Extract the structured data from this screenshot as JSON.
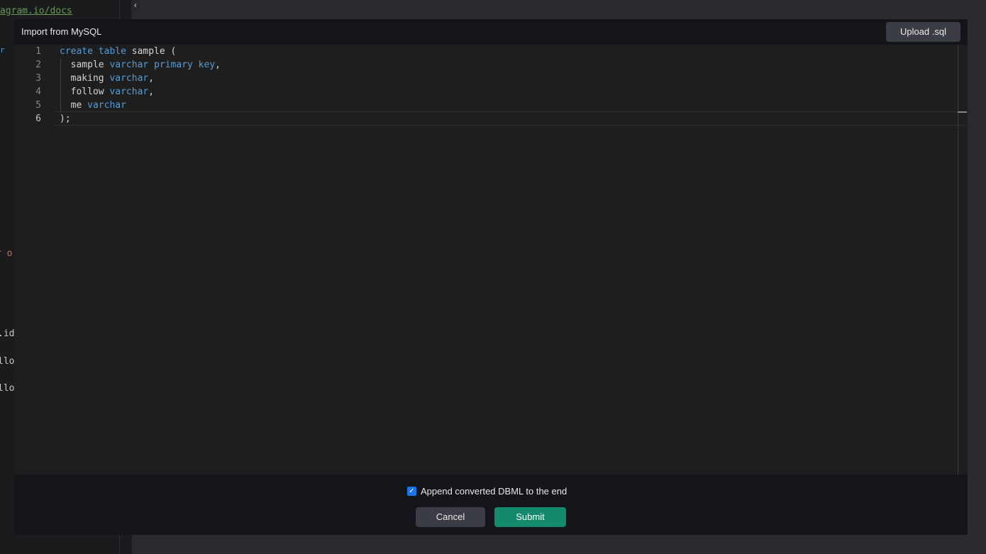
{
  "background": {
    "fragments": [
      "agram.io/docs",
      "r",
      "r o",
      ".id",
      "llo",
      "llo"
    ],
    "toggle_glyph": "‹"
  },
  "modal": {
    "title": "Import from MySQL",
    "upload_label": "Upload .sql",
    "editor": {
      "active_line": 6,
      "lines": [
        {
          "number": "1",
          "tokens": [
            {
              "t": "create table",
              "k": true
            },
            {
              "t": " sample (",
              "k": false
            }
          ]
        },
        {
          "number": "2",
          "tokens": [
            {
              "t": "  sample ",
              "k": false
            },
            {
              "t": "varchar primary key",
              "k": true
            },
            {
              "t": ",",
              "k": false
            }
          ]
        },
        {
          "number": "3",
          "tokens": [
            {
              "t": "  making ",
              "k": false
            },
            {
              "t": "varchar",
              "k": true
            },
            {
              "t": ",",
              "k": false
            }
          ]
        },
        {
          "number": "4",
          "tokens": [
            {
              "t": "  follow ",
              "k": false
            },
            {
              "t": "varchar",
              "k": true
            },
            {
              "t": ",",
              "k": false
            }
          ]
        },
        {
          "number": "5",
          "tokens": [
            {
              "t": "  me ",
              "k": false
            },
            {
              "t": "varchar",
              "k": true
            }
          ]
        },
        {
          "number": "6",
          "tokens": [
            {
              "t": ");",
              "k": false
            }
          ]
        }
      ]
    },
    "footer": {
      "append_checked": true,
      "append_label": "Append converted DBML to the end",
      "cancel_label": "Cancel",
      "submit_label": "Submit"
    }
  },
  "colors": {
    "keyword": "#569cd6",
    "submit": "#138a6a",
    "checkbox": "#1a73e8"
  }
}
